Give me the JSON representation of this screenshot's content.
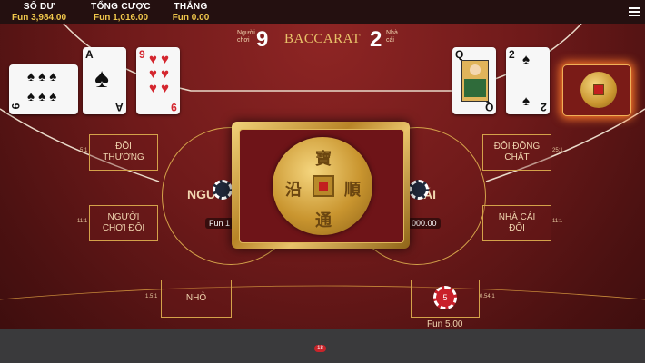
{
  "header": {
    "balance_label": "SỐ DƯ",
    "balance_value": "Fun 3,984.00",
    "total_bet_label": "TỔNG CƯỢC",
    "total_bet_value": "Fun 1,016.00",
    "win_label": "THẮNG",
    "win_value": "Fun 0.00",
    "menu_icon": "hamburger-menu-icon"
  },
  "scoreboard": {
    "player_label_line1": "Người",
    "player_label_line2": "chơi",
    "player_score": "9",
    "title": "BACCARAT",
    "banker_score": "2",
    "banker_label_line1": "Nhà",
    "banker_label_line2": "cái"
  },
  "player_cards": [
    {
      "rank": "6",
      "suit": "♠",
      "color": "black"
    },
    {
      "rank": "A",
      "suit": "♠",
      "color": "black"
    },
    {
      "rank": "9",
      "suit": "♥",
      "color": "red"
    }
  ],
  "banker_cards": [
    {
      "rank": "Q",
      "suit": "♠",
      "color": "black"
    },
    {
      "rank": "2",
      "suit": "♠",
      "color": "black"
    }
  ],
  "bets": {
    "player_pair_label": "ĐÔI THƯỜNG",
    "player_pair_odds": "5:1",
    "player_pair2_label": "NGƯỜI CHƠI ĐÔI",
    "player_pair2_odds": "11:1",
    "small_label": "NHỎ",
    "small_odds": "1.5:1",
    "banker_pair_label": "ĐÔI ĐỒNG CHẤT",
    "banker_pair_odds": "25:1",
    "banker_pair2_label": "NHÀ CÁI ĐÔI",
    "banker_pair2_odds": "11:1",
    "big_odds": "0.54:1",
    "player_main_partial": "NGƯ",
    "banker_main_partial": "ÁI",
    "player_amount_partial": "Fun 1",
    "banker_amount_partial": "000.00",
    "chip_value": "5",
    "chip_amount": "Fun 5.00"
  },
  "bottom": {
    "badge": "18"
  },
  "colors": {
    "felt": "#6f1a1a",
    "gold": "#d4a24a",
    "accent_yellow": "#f2c94c",
    "chip_red": "#c9202a"
  }
}
